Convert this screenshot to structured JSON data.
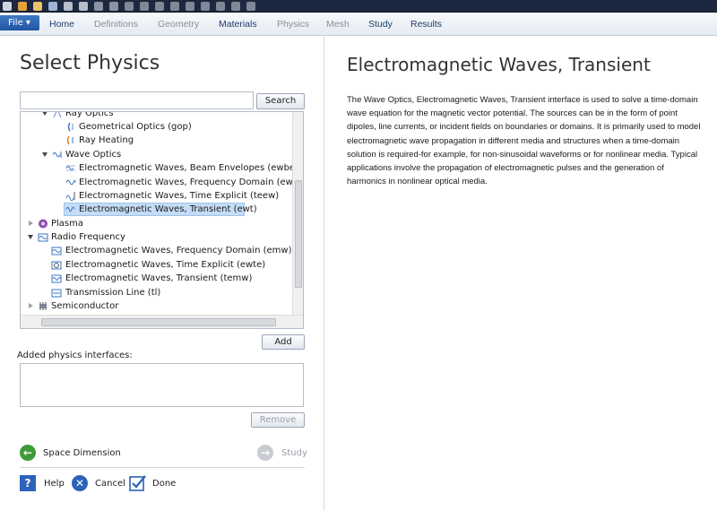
{
  "ribbon": {
    "file_label": "File ▾",
    "tabs": [
      {
        "label": "Home",
        "enabled": true
      },
      {
        "label": "Definitions",
        "enabled": false
      },
      {
        "label": "Geometry",
        "enabled": false
      },
      {
        "label": "Materials",
        "enabled": true
      },
      {
        "label": "Physics",
        "enabled": false
      },
      {
        "label": "Mesh",
        "enabled": false
      },
      {
        "label": "Study",
        "enabled": true
      },
      {
        "label": "Results",
        "enabled": true
      }
    ]
  },
  "left": {
    "title": "Select Physics",
    "search": {
      "value": "",
      "button_label": "Search"
    },
    "tree": [
      {
        "label": "Ray Optics",
        "indent": 1,
        "icon": "ray-optics-icon",
        "twisty": "open"
      },
      {
        "label": "Geometrical Optics (gop)",
        "indent": 2,
        "icon": "geometrical-optics-icon"
      },
      {
        "label": "Ray Heating",
        "indent": 2,
        "icon": "ray-heating-icon"
      },
      {
        "label": "Wave Optics",
        "indent": 1,
        "icon": "wave-optics-icon",
        "twisty": "open"
      },
      {
        "label": "Electromagnetic Waves, Beam Envelopes (ewbe)",
        "indent": 2,
        "icon": "beam-envelopes-icon"
      },
      {
        "label": "Electromagnetic Waves, Frequency Domain (ewfd)",
        "indent": 2,
        "icon": "frequency-domain-icon"
      },
      {
        "label": "Electromagnetic Waves, Time Explicit (teew)",
        "indent": 2,
        "icon": "time-explicit-icon"
      },
      {
        "label": "Electromagnetic Waves, Transient (ewt)",
        "indent": 2,
        "icon": "transient-icon",
        "selected": true
      },
      {
        "label": "Plasma",
        "indent": 0,
        "icon": "plasma-icon",
        "twisty": "closed"
      },
      {
        "label": "Radio Frequency",
        "indent": 0,
        "icon": "radio-frequency-icon",
        "twisty": "open"
      },
      {
        "label": "Electromagnetic Waves, Frequency Domain (emw)",
        "indent": 1,
        "icon": "emw-frequency-icon"
      },
      {
        "label": "Electromagnetic Waves, Time Explicit (ewte)",
        "indent": 1,
        "icon": "ewte-time-icon"
      },
      {
        "label": "Electromagnetic Waves, Transient (temw)",
        "indent": 1,
        "icon": "temw-transient-icon"
      },
      {
        "label": "Transmission Line (tl)",
        "indent": 1,
        "icon": "transmission-line-icon"
      },
      {
        "label": "Semiconductor",
        "indent": 0,
        "icon": "semiconductor-icon",
        "twisty": "closed"
      }
    ],
    "add_label": "Add",
    "added_label": "Added physics interfaces:",
    "remove_label": "Remove",
    "back_label": "Space Dimension",
    "next_label": "Study",
    "help_label": "Help",
    "cancel_label": "Cancel",
    "done_label": "Done"
  },
  "right": {
    "title": "Electromagnetic Waves, Transient",
    "description": "The Wave Optics, Electromagnetic Waves, Transient interface is used to solve a time-domain wave equation for the magnetic vector potential. The sources can be in the form of point dipoles, line currents, or incident fields on boundaries or domains. It is primarily used to model electromagnetic wave propagation in different media and structures when a time-domain solution is required-for example, for non-sinusoidal waveforms or for nonlinear media. Typical applications involve the propagation of electromagnetic pulses and the generation of harmonics in nonlinear optical media."
  },
  "colors": {
    "accent": "#1f55a3",
    "selection": "#c4dcf5",
    "back_green": "#3e9b3a",
    "help_blue": "#2c62b8"
  }
}
